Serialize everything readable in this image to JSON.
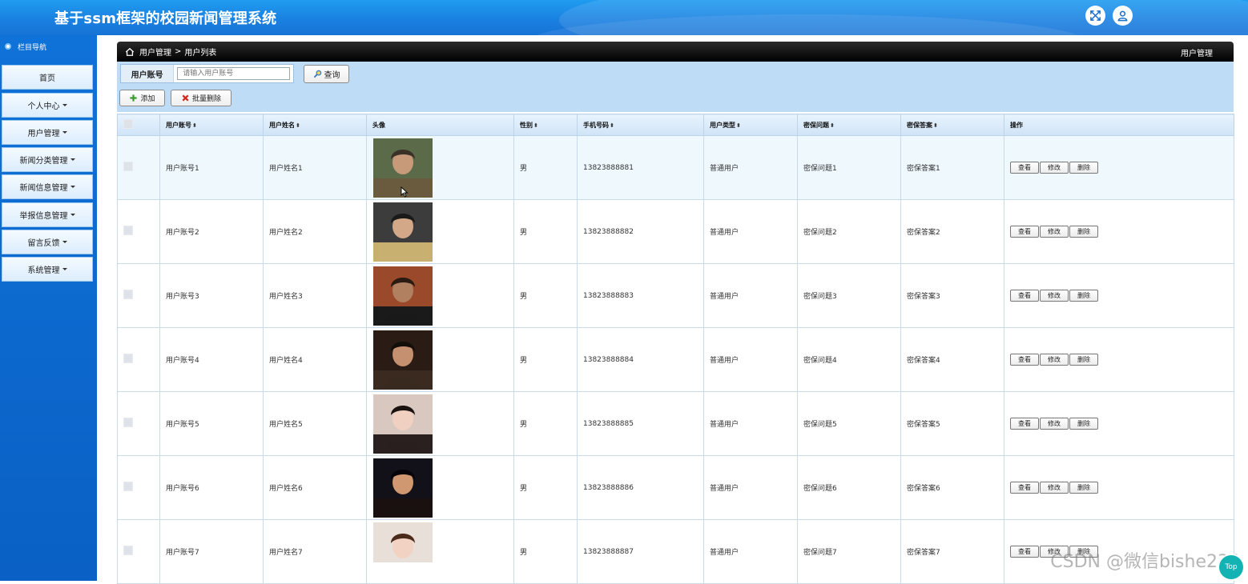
{
  "header": {
    "title": "基于ssm框架的校园新闻管理系统",
    "icons": [
      "fullscreen-icon",
      "user-icon"
    ],
    "brand_color": "#1a7fe0"
  },
  "sidebar": {
    "caption": "栏目导航",
    "items": [
      {
        "label": "首页",
        "has_caret": false
      },
      {
        "label": "个人中心",
        "has_caret": true
      },
      {
        "label": "用户管理",
        "has_caret": true
      },
      {
        "label": "新闻分类管理",
        "has_caret": true
      },
      {
        "label": "新闻信息管理",
        "has_caret": true
      },
      {
        "label": "举报信息管理",
        "has_caret": true
      },
      {
        "label": "留言反馈",
        "has_caret": true
      },
      {
        "label": "系统管理",
        "has_caret": true
      }
    ]
  },
  "breadcrumb": {
    "items": [
      "用户管理",
      "用户列表"
    ],
    "separator": ">",
    "right_label": "用户管理"
  },
  "search": {
    "label": "用户账号",
    "placeholder": "请输入用户账号",
    "value": "",
    "button_label": "查询"
  },
  "actions": {
    "add_label": "添加",
    "batch_delete_label": "批量删除"
  },
  "table": {
    "columns": [
      "用户账号",
      "用户姓名",
      "头像",
      "性别",
      "手机号码",
      "用户类型",
      "密保问题",
      "密保答案",
      "操作"
    ],
    "sortable": [
      true,
      true,
      false,
      true,
      true,
      true,
      true,
      true,
      false
    ],
    "row_actions": [
      "查看",
      "修改",
      "删除"
    ],
    "rows": [
      {
        "account": "用户账号1",
        "name": "用户姓名1",
        "gender": "男",
        "phone": "13823888881",
        "type": "普通用户",
        "question": "密保问题1",
        "answer": "密保答案1"
      },
      {
        "account": "用户账号2",
        "name": "用户姓名2",
        "gender": "男",
        "phone": "13823888882",
        "type": "普通用户",
        "question": "密保问题2",
        "answer": "密保答案2"
      },
      {
        "account": "用户账号3",
        "name": "用户姓名3",
        "gender": "男",
        "phone": "13823888883",
        "type": "普通用户",
        "question": "密保问题3",
        "answer": "密保答案3"
      },
      {
        "account": "用户账号4",
        "name": "用户姓名4",
        "gender": "男",
        "phone": "13823888884",
        "type": "普通用户",
        "question": "密保问题4",
        "answer": "密保答案4"
      },
      {
        "account": "用户账号5",
        "name": "用户姓名5",
        "gender": "男",
        "phone": "13823888885",
        "type": "普通用户",
        "question": "密保问题5",
        "answer": "密保答案5"
      },
      {
        "account": "用户账号6",
        "name": "用户姓名6",
        "gender": "男",
        "phone": "13823888886",
        "type": "普通用户",
        "question": "密保问题6",
        "answer": "密保答案6"
      },
      {
        "account": "用户账号7",
        "name": "用户姓名7",
        "gender": "男",
        "phone": "13823888887",
        "type": "普通用户",
        "question": "密保问题7",
        "answer": "密保答案7"
      }
    ]
  },
  "watermark": "CSDN @微信bishe234",
  "top_button_label": "Top"
}
